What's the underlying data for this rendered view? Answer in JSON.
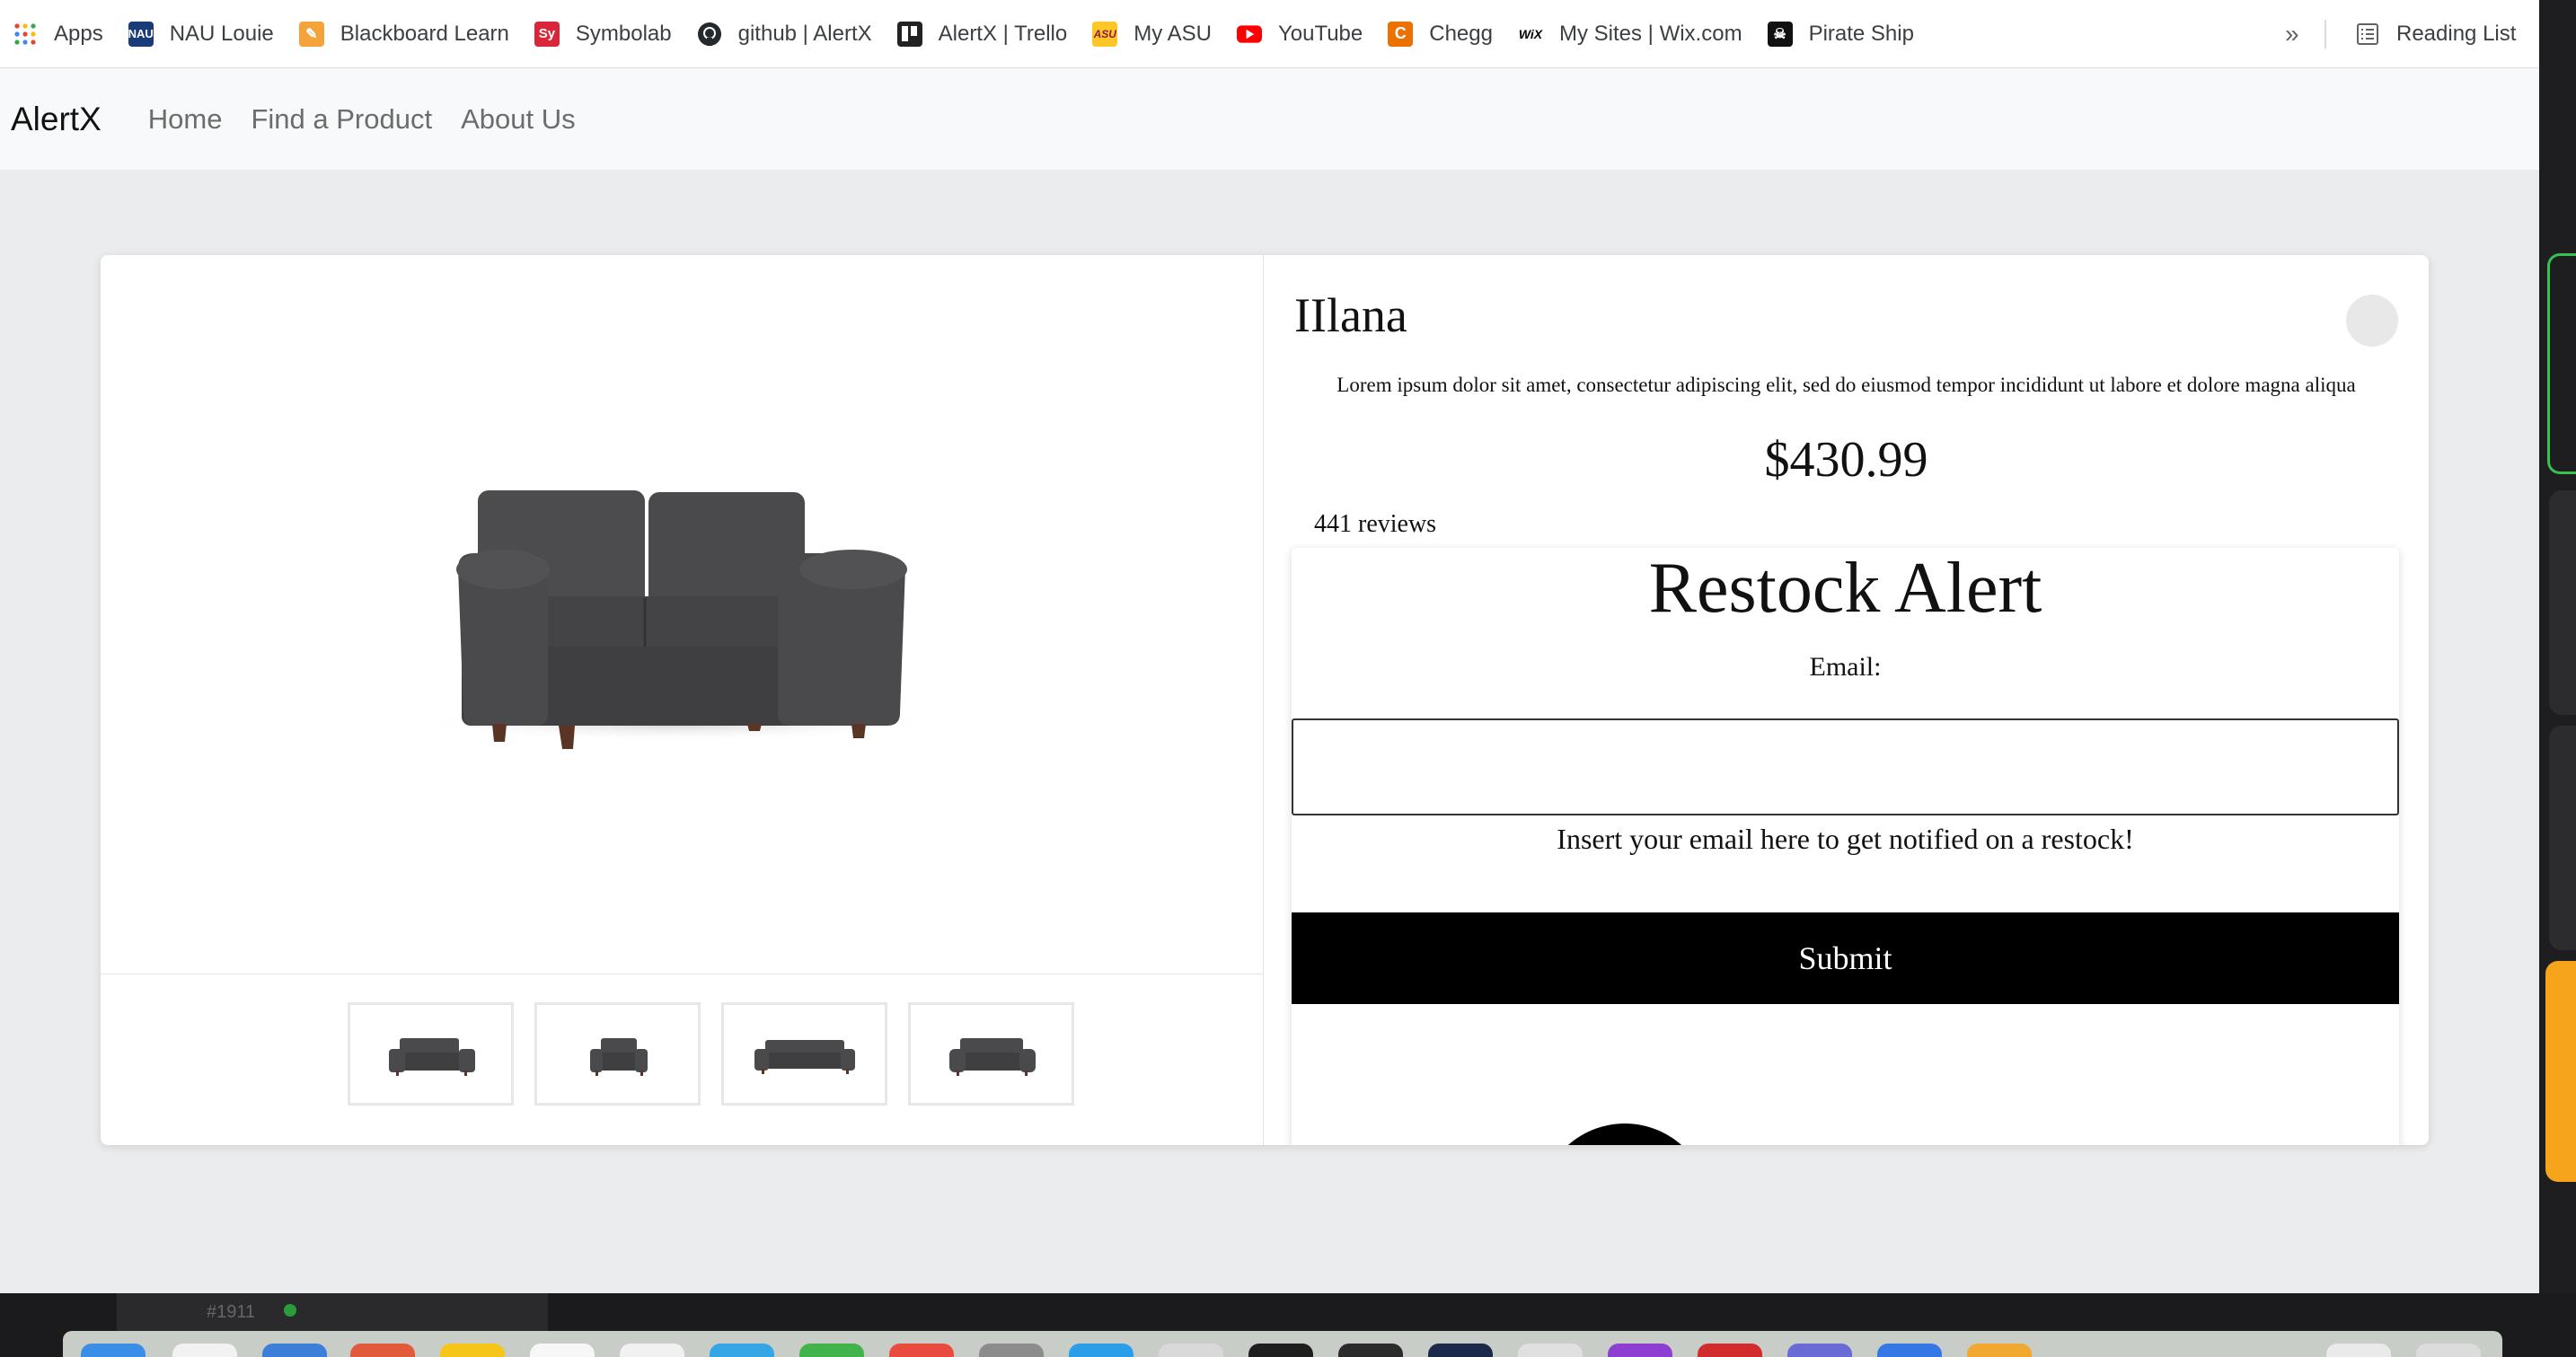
{
  "bookmarks": {
    "items": [
      {
        "label": "Apps",
        "icon": "apps-grid-icon",
        "color": "#ea4335"
      },
      {
        "label": "NAU Louie",
        "icon": "nau-icon",
        "color": "#1a3b7a"
      },
      {
        "label": "Blackboard Learn",
        "icon": "pencil-icon",
        "color": "#f3a33a"
      },
      {
        "label": "Symbolab",
        "icon": "symbolab-icon",
        "color": "#d9263b"
      },
      {
        "label": "github | AlertX",
        "icon": "github-icon",
        "color": "#24292e"
      },
      {
        "label": "AlertX | Trello",
        "icon": "trello-icon",
        "color": "#222222"
      },
      {
        "label": "My ASU",
        "icon": "asu-icon",
        "color": "#8c1d40"
      },
      {
        "label": "YouTube",
        "icon": "youtube-icon",
        "color": "#ff0000"
      },
      {
        "label": "Chegg",
        "icon": "chegg-icon",
        "color": "#eb7100"
      },
      {
        "label": "My Sites | Wix.com",
        "icon": "wix-icon",
        "color": "#000000"
      },
      {
        "label": "Pirate Ship",
        "icon": "pirate-icon",
        "color": "#111111"
      }
    ],
    "more": "»",
    "reading_list": "Reading List"
  },
  "navbar": {
    "brand": "AlertX",
    "links": [
      "Home",
      "Find a Product",
      "About Us"
    ]
  },
  "product": {
    "name": "IIlana",
    "description": "Lorem ipsum dolor sit amet, consectetur adipiscing elit, sed do eiusmod tempor incididunt ut labore et dolore magna aliqua",
    "price": "$430.99",
    "reviews": "441 reviews",
    "sofa_color": "#4a4a4c",
    "leg_color": "#5a3526"
  },
  "restock_alert": {
    "title": "Restock Alert",
    "email_label": "Email:",
    "email_value": "",
    "help_text": "Insert your email here to get notified on a restock!",
    "submit_label": "Submit"
  },
  "background_window": {
    "label": "#1911"
  }
}
